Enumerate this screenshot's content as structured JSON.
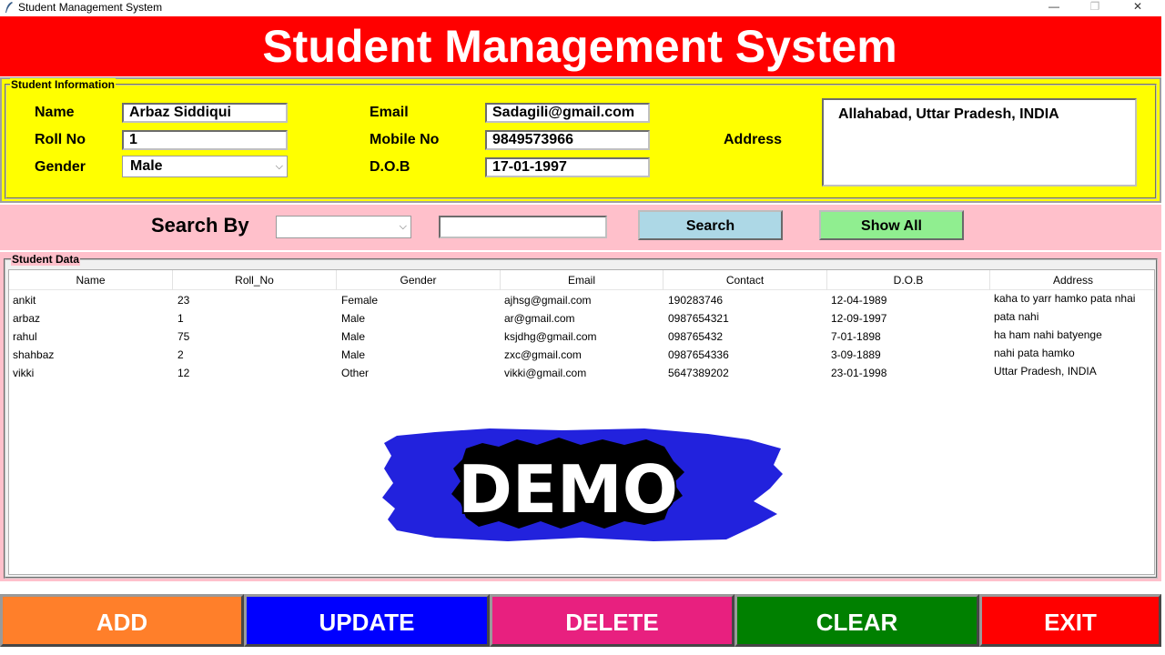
{
  "window": {
    "title": "Student Management System",
    "minimize_glyph": "—",
    "maximize_glyph": "❐",
    "close_glyph": "✕"
  },
  "header": {
    "title": "Student Management System",
    "color": "#ff0000"
  },
  "info": {
    "legend": "Student Information",
    "name_label": "Name",
    "name_value": "Arbaz Siddiqui",
    "roll_label": "Roll No",
    "roll_value": "1",
    "gender_label": "Gender",
    "gender_value": "Male",
    "email_label": "Email",
    "email_value": "Sadagili@gmail.com",
    "mobile_label": "Mobile No",
    "mobile_value": "9849573966",
    "dob_label": "D.O.B",
    "dob_value": "17-01-1997",
    "address_label": "Address",
    "address_value": "Allahabad, Uttar Pradesh, INDIA"
  },
  "search": {
    "label": "Search By",
    "by_value": "",
    "text_value": "",
    "search_button": "Search",
    "show_all_button": "Show All"
  },
  "data_table": {
    "legend": "Student Data",
    "columns": [
      "Name",
      "Roll_No",
      "Gender",
      "Email",
      "Contact",
      "D.O.B",
      "Address"
    ],
    "rows": [
      [
        "ankit",
        "23",
        "Female",
        "ajhsg@gmail.com",
        "190283746",
        "12-04-1989",
        "kaha to yarr hamko pata nhai"
      ],
      [
        "arbaz",
        "1",
        "Male",
        "ar@gmail.com",
        "0987654321",
        "12-09-1997",
        "pata nahi"
      ],
      [
        "rahul",
        "75",
        "Male",
        "ksjdhg@gmail.com",
        "098765432",
        "7-01-1898",
        "ha ham nahi batyenge"
      ],
      [
        "shahbaz",
        "2",
        "Male",
        "zxc@gmail.com",
        "0987654336",
        "3-09-1889",
        "nahi pata hamko"
      ],
      [
        "vikki",
        "12",
        "Other",
        "vikki@gmail.com",
        "5647389202",
        "23-01-1998",
        "Uttar Pradesh, INDIA"
      ]
    ]
  },
  "overlay": {
    "demo_text": "DEMO"
  },
  "footer": {
    "add": "ADD",
    "update": "UPDATE",
    "delete": "DELETE",
    "clear": "CLEAR",
    "exit": "EXIT",
    "colors": {
      "add": "#ff7f2a",
      "update": "#0000ff",
      "delete": "#e8207f",
      "clear": "#008000",
      "exit": "#ff0000"
    }
  }
}
